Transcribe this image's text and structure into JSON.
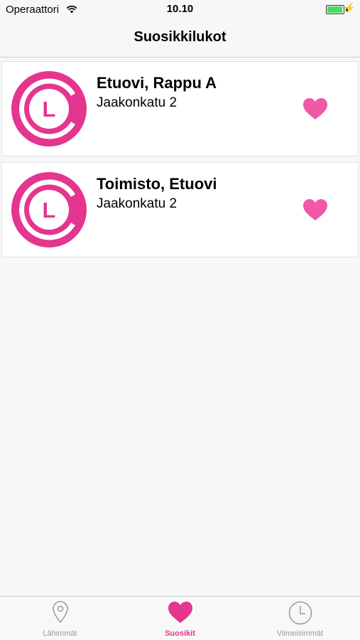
{
  "status_bar": {
    "carrier": "Operaattori",
    "time": "10.10",
    "battery_level": 0.95
  },
  "nav": {
    "title": "Suosikkilukot"
  },
  "colors": {
    "brand": "#e4358f",
    "heart": "#f058a8",
    "tab_inactive": "#9a9a9a"
  },
  "locks": [
    {
      "name": "Etuovi, Rappu A",
      "address": "Jaakonkatu 2",
      "logo_letter": "L",
      "favorite": true
    },
    {
      "name": "Toimisto, Etuovi",
      "address": "Jaakonkatu 2",
      "logo_letter": "L",
      "favorite": true
    }
  ],
  "tabs": [
    {
      "label": "Lähimmät",
      "icon": "location-pin-icon",
      "active": false
    },
    {
      "label": "Suosikit",
      "icon": "heart-icon",
      "active": true
    },
    {
      "label": "Viimeisimmät",
      "icon": "clock-icon",
      "active": false
    }
  ]
}
